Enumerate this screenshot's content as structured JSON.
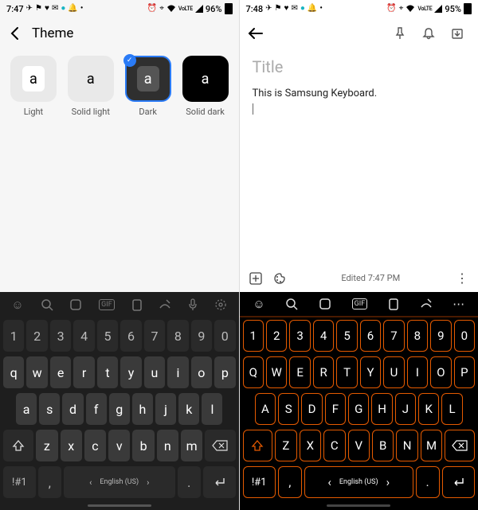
{
  "left": {
    "status": {
      "time": "7:47",
      "battery": "96%",
      "lte": "VoLTE"
    },
    "header": {
      "title": "Theme"
    },
    "themes": [
      {
        "label": "Light",
        "letter": "a"
      },
      {
        "label": "Solid light",
        "letter": "a"
      },
      {
        "label": "Dark",
        "letter": "a",
        "selected": true
      },
      {
        "label": "Solid dark",
        "letter": "a"
      }
    ],
    "keyboard": {
      "lang": "English (US)",
      "row_num": [
        "1",
        "2",
        "3",
        "4",
        "5",
        "6",
        "7",
        "8",
        "9",
        "0"
      ],
      "row1": [
        "q",
        "w",
        "e",
        "r",
        "t",
        "y",
        "u",
        "i",
        "o",
        "p"
      ],
      "row2": [
        "a",
        "s",
        "d",
        "f",
        "g",
        "h",
        "j",
        "k",
        "l"
      ],
      "row3": [
        "z",
        "x",
        "c",
        "v",
        "b",
        "n",
        "m"
      ],
      "sym": "!#1",
      "comma": ",",
      "period": "."
    }
  },
  "right": {
    "status": {
      "time": "7:48",
      "battery": "95%",
      "lte": "VoLTE"
    },
    "note": {
      "title_placeholder": "Title",
      "body": "This is Samsung Keyboard.",
      "edited": "Edited 7:47 PM"
    },
    "keyboard": {
      "lang": "English (US)",
      "row_num": [
        "1",
        "2",
        "3",
        "4",
        "5",
        "6",
        "7",
        "8",
        "9",
        "0"
      ],
      "row1": [
        "Q",
        "W",
        "E",
        "R",
        "T",
        "Y",
        "U",
        "I",
        "O",
        "P"
      ],
      "row2": [
        "A",
        "S",
        "D",
        "F",
        "G",
        "H",
        "J",
        "K",
        "L"
      ],
      "row3": [
        "Z",
        "X",
        "C",
        "V",
        "B",
        "N",
        "M"
      ],
      "sym": "!#1",
      "comma": ",",
      "period": "."
    }
  }
}
